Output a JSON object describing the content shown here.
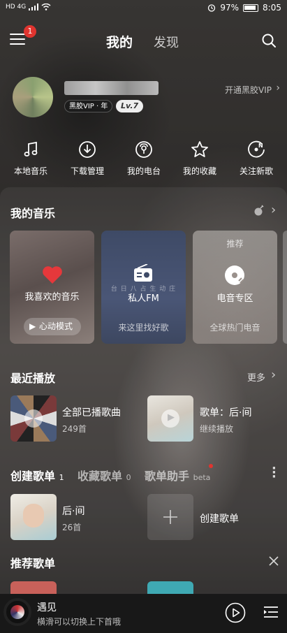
{
  "status_bar": {
    "left_text": "HD 4G",
    "battery": "97%",
    "time": "8:05"
  },
  "header": {
    "menu_badge": "1",
    "tab_mine": "我的",
    "tab_discover": "发现"
  },
  "profile": {
    "vip_badge": "黑胶VIP · 年",
    "level": "Lv.7",
    "open_vip": "开通黑胶VIP"
  },
  "quick_nav": [
    {
      "label": "本地音乐",
      "icon": "music-note-icon"
    },
    {
      "label": "下载管理",
      "icon": "download-icon"
    },
    {
      "label": "我的电台",
      "icon": "radio-icon"
    },
    {
      "label": "我的收藏",
      "icon": "star-icon"
    },
    {
      "label": "关注新歌",
      "icon": "new-song-icon"
    }
  ],
  "my_music": {
    "title": "我的音乐",
    "cards": [
      {
        "title": "我喜欢的音乐",
        "sub": "心动模式"
      },
      {
        "title": "私人FM",
        "sub": "来这里找好歌",
        "overlay": "台 日 八 占 生 动 庄"
      },
      {
        "title": "电音专区",
        "sub": "全球热门电音",
        "tag": "推荐"
      }
    ]
  },
  "recent": {
    "title": "最近播放",
    "more": "更多",
    "items": [
      {
        "title": "全部已播歌曲",
        "sub": "249首"
      },
      {
        "title": "歌单：后·间",
        "sub": "继续播放"
      }
    ]
  },
  "playlists": {
    "tab_created": "创建歌单",
    "tab_created_count": "1",
    "tab_collected": "收藏歌单",
    "tab_collected_count": "0",
    "tab_helper": "歌单助手",
    "tab_helper_tag": "beta",
    "items": [
      {
        "title": "后·间",
        "sub": "26首"
      }
    ],
    "create_label": "创建歌单"
  },
  "recommend": {
    "title": "推荐歌单"
  },
  "player": {
    "song": "遇见",
    "hint": "横滑可以切换上下首哦"
  }
}
